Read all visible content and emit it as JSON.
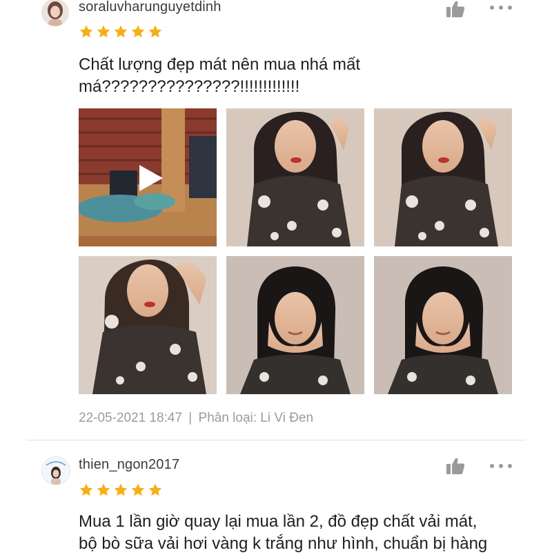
{
  "reviews": [
    {
      "username": "soraluvharunguyetdinh",
      "rating": 5,
      "text_lines": [
        "Chất lượng đẹp mát nên mua nhá mất",
        "má???????????????!!!!!!!!!!!!!"
      ],
      "timestamp": "22-05-2021 18:47",
      "separator": "|",
      "variation": "Phân loại: Li Vi Đen",
      "media": [
        {
          "type": "video",
          "icon": "play-icon"
        },
        {
          "type": "photo"
        },
        {
          "type": "photo"
        },
        {
          "type": "photo"
        },
        {
          "type": "photo"
        },
        {
          "type": "photo"
        }
      ]
    },
    {
      "username": "thien_ngon2017",
      "rating": 5,
      "text_lines": [
        "Mua 1 lần giờ quay lại mua lần 2, đồ đẹp chất vải mát,",
        "bộ bò sữa vải hơi vàng k trắng như hình, chuẩn bị hàng"
      ]
    }
  ],
  "icons": {
    "like": "thumbs-up-icon",
    "more": "more-options-icon",
    "star": "star-icon"
  },
  "colors": {
    "star": "#f5b018",
    "meta": "#9b9b9b",
    "icon": "#9a9a9a",
    "divider": "#e1e1e1"
  }
}
